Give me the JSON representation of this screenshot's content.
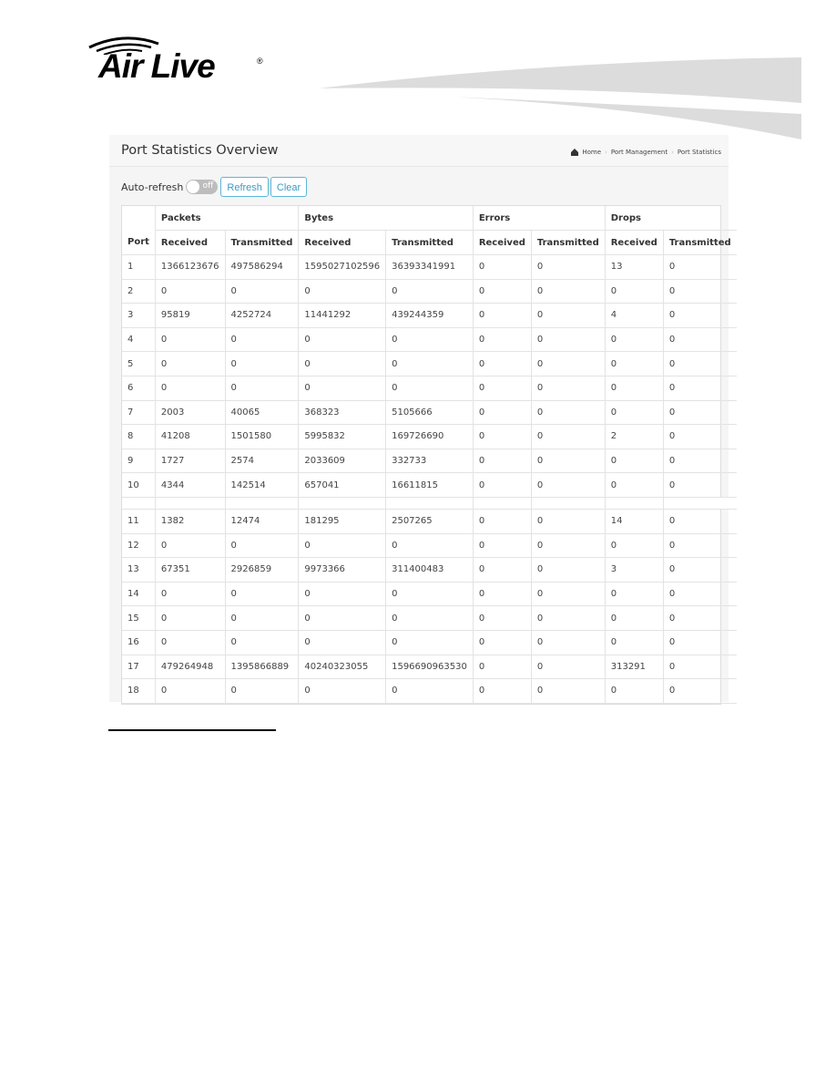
{
  "brand": {
    "logo_text": "Air Live",
    "registered_mark": "®"
  },
  "page": {
    "title": "Port Statistics Overview",
    "breadcrumb": [
      {
        "label": "Home",
        "icon": "home-icon"
      },
      {
        "label": "Port Management"
      },
      {
        "label": "Port Statistics"
      }
    ]
  },
  "toolbar": {
    "auto_refresh_label": "Auto-refresh",
    "auto_refresh_state": "off",
    "refresh_label": "Refresh",
    "clear_label": "Clear"
  },
  "table": {
    "port_header": "Port",
    "groups": [
      "Packets",
      "Bytes",
      "Errors",
      "Drops"
    ],
    "sub_headers": [
      "Received",
      "Transmitted",
      "Received",
      "Transmitted",
      "Received",
      "Transmitted",
      "Received",
      "Transmitted"
    ],
    "rows": [
      [
        "1",
        "1366123676",
        "497586294",
        "1595027102596",
        "36393341991",
        "0",
        "0",
        "13",
        "0"
      ],
      [
        "2",
        "0",
        "0",
        "0",
        "0",
        "0",
        "0",
        "0",
        "0"
      ],
      [
        "3",
        "95819",
        "4252724",
        "11441292",
        "439244359",
        "0",
        "0",
        "4",
        "0"
      ],
      [
        "4",
        "0",
        "0",
        "0",
        "0",
        "0",
        "0",
        "0",
        "0"
      ],
      [
        "5",
        "0",
        "0",
        "0",
        "0",
        "0",
        "0",
        "0",
        "0"
      ],
      [
        "6",
        "0",
        "0",
        "0",
        "0",
        "0",
        "0",
        "0",
        "0"
      ],
      [
        "7",
        "2003",
        "40065",
        "368323",
        "5105666",
        "0",
        "0",
        "0",
        "0"
      ],
      [
        "8",
        "41208",
        "1501580",
        "5995832",
        "169726690",
        "0",
        "0",
        "2",
        "0"
      ],
      [
        "9",
        "1727",
        "2574",
        "2033609",
        "332733",
        "0",
        "0",
        "0",
        "0"
      ],
      [
        "10",
        "4344",
        "142514",
        "657041",
        "16611815",
        "0",
        "0",
        "0",
        "0"
      ],
      [
        "11",
        "1382",
        "12474",
        "181295",
        "2507265",
        "0",
        "0",
        "14",
        "0"
      ],
      [
        "12",
        "0",
        "0",
        "0",
        "0",
        "0",
        "0",
        "0",
        "0"
      ],
      [
        "13",
        "67351",
        "2926859",
        "9973366",
        "311400483",
        "0",
        "0",
        "3",
        "0"
      ],
      [
        "14",
        "0",
        "0",
        "0",
        "0",
        "0",
        "0",
        "0",
        "0"
      ],
      [
        "15",
        "0",
        "0",
        "0",
        "0",
        "0",
        "0",
        "0",
        "0"
      ],
      [
        "16",
        "0",
        "0",
        "0",
        "0",
        "0",
        "0",
        "0",
        "0"
      ],
      [
        "17",
        "479264948",
        "1395866889",
        "40240323055",
        "1596690963530",
        "0",
        "0",
        "313291",
        "0"
      ],
      [
        "18",
        "0",
        "0",
        "0",
        "0",
        "0",
        "0",
        "0",
        "0"
      ]
    ]
  }
}
